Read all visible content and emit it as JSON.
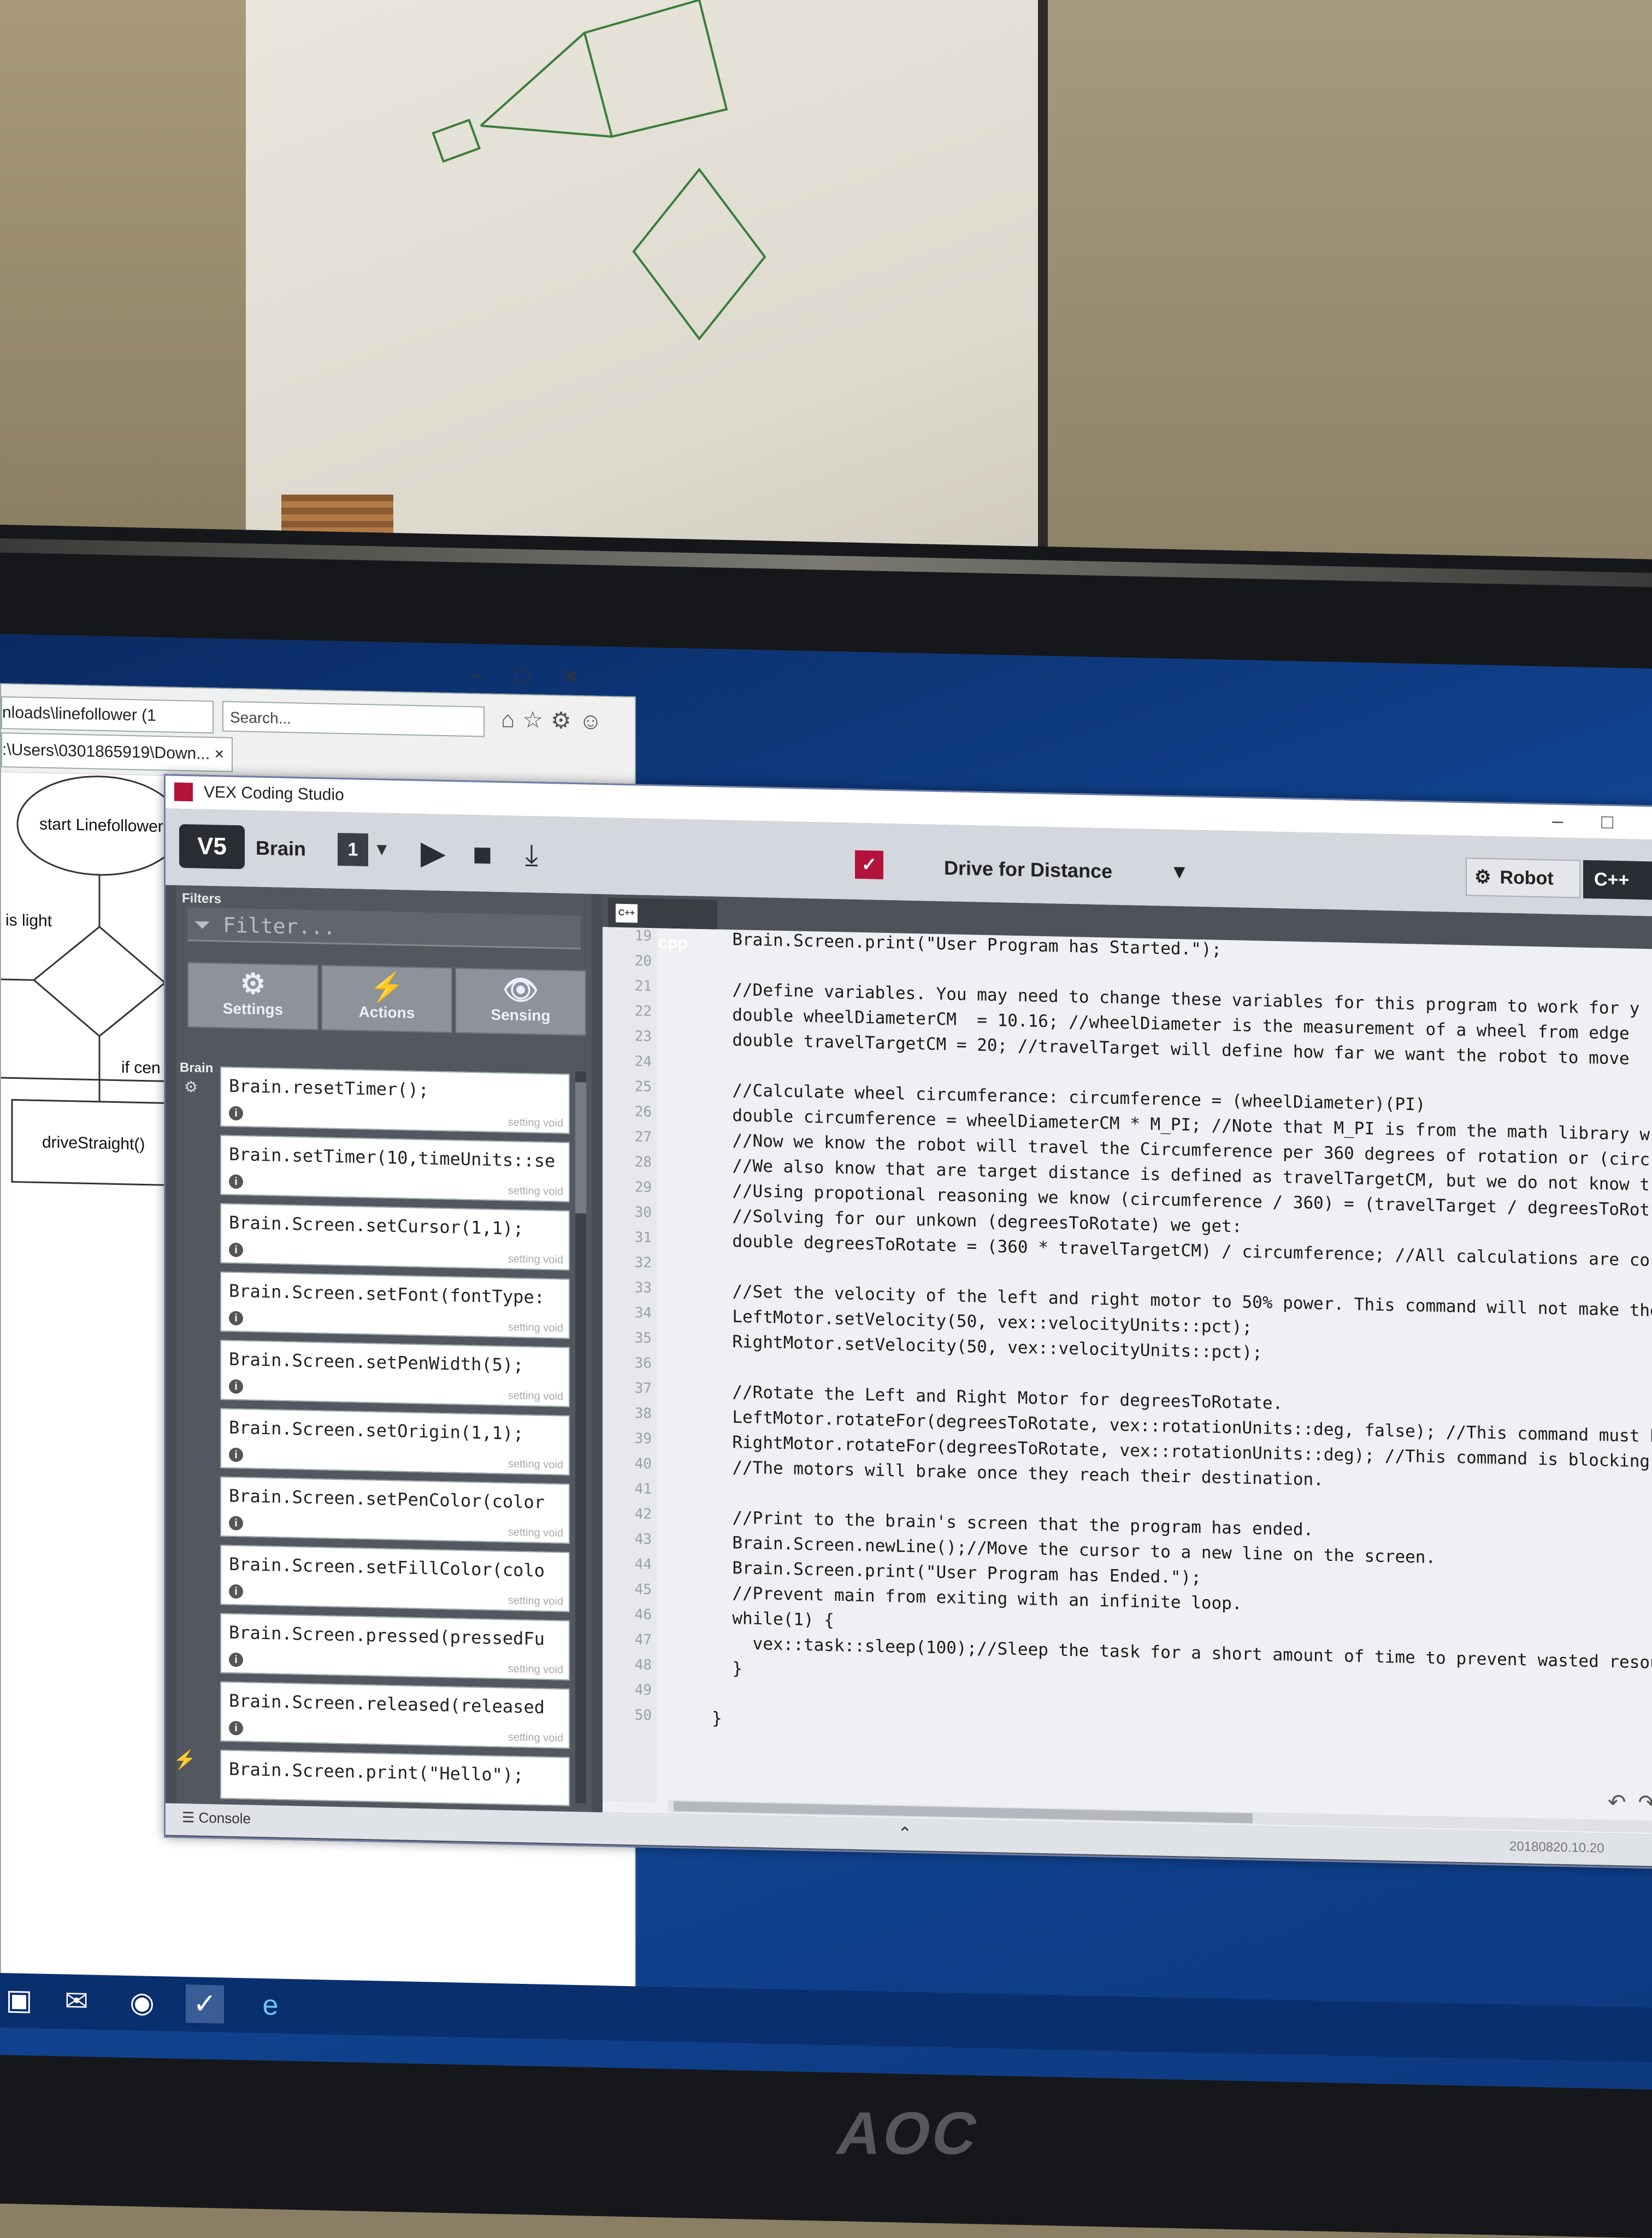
{
  "ie_window": {
    "address": "nloads\\linefollower (1",
    "search_placeholder": "Search...",
    "tab_label": ":\\Users\\0301865919\\Down...",
    "tab_close": "×",
    "flowchart": {
      "start_label": "start Linefollower",
      "condition_label": "is light",
      "branch_label": "if cen",
      "action_label": "driveStraight()"
    }
  },
  "vex": {
    "title": "VEX Coding Studio",
    "brain_label": "Brain",
    "slot_number": "1",
    "project_name": "Drive for Distance",
    "robot_button": "Robot",
    "filters_label": "Filters",
    "filter_placeholder": "Filter...",
    "categories": [
      {
        "label": "Settings",
        "icon": "gears-icon"
      },
      {
        "label": "Actions",
        "icon": "lightning-icon"
      },
      {
        "label": "Sensing",
        "icon": "eye-icon"
      }
    ],
    "brain_section": "Brain",
    "commands": [
      {
        "code": "Brain.resetTimer();",
        "type": "setting void"
      },
      {
        "code": "Brain.setTimer(10,timeUnits::se",
        "type": "setting void"
      },
      {
        "code": "Brain.Screen.setCursor(1,1);",
        "type": "setting void"
      },
      {
        "code": "Brain.Screen.setFont(fontType:",
        "type": "setting void"
      },
      {
        "code": "Brain.Screen.setPenWidth(5);",
        "type": "setting void"
      },
      {
        "code": "Brain.Screen.setOrigin(1,1);",
        "type": "setting void"
      },
      {
        "code": "Brain.Screen.setPenColor(color",
        "type": "setting void"
      },
      {
        "code": "Brain.Screen.setFillColor(colo",
        "type": "setting void"
      },
      {
        "code": "Brain.Screen.pressed(pressedFu",
        "type": "setting void"
      },
      {
        "code": "Brain.Screen.released(released",
        "type": "setting void"
      },
      {
        "code": "Brain.Screen.print(\"Hello\");",
        "type": ""
      }
    ],
    "file_tab": "main.cpp",
    "cpp_badge": "C++",
    "code_lines": [
      {
        "n": "19",
        "text": "  Brain.Screen.print(\"User Program has Started.\");"
      },
      {
        "n": "20",
        "text": ""
      },
      {
        "n": "21",
        "text": "  //Define variables. You may need to change these variables for this program to work for y"
      },
      {
        "n": "22",
        "text": "  double wheelDiameterCM  = 10.16; //wheelDiameter is the measurement of a wheel from edge"
      },
      {
        "n": "23",
        "text": "  double travelTargetCM = 20; //travelTarget will define how far we want the robot to move"
      },
      {
        "n": "24",
        "text": ""
      },
      {
        "n": "25",
        "text": "  //Calculate wheel circumferance: circumference = (wheelDiameter)(PI)"
      },
      {
        "n": "26",
        "text": "  double circumference = wheelDiameterCM * M_PI; //Note that M_PI is from the math library w"
      },
      {
        "n": "27",
        "text": "  //Now we know the robot will travel the Circumference per 360 degrees of rotation or (circ"
      },
      {
        "n": "28",
        "text": "  //We also know that are target distance is defined as travelTargetCM, but we do not know t"
      },
      {
        "n": "29",
        "text": "  //Using propotional reasoning we know (circumference / 360) = (travelTarget / degreesToRot"
      },
      {
        "n": "30",
        "text": "  //Solving for our unkown (degreesToRotate) we get:"
      },
      {
        "n": "31",
        "text": "  double degreesToRotate = (360 * travelTargetCM) / circumference; //All calculations are co"
      },
      {
        "n": "32",
        "text": ""
      },
      {
        "n": "33",
        "text": "  //Set the velocity of the left and right motor to 50% power. This command will not make the"
      },
      {
        "n": "34",
        "text": "  LeftMotor.setVelocity(50, vex::velocityUnits::pct);"
      },
      {
        "n": "35",
        "text": "  RightMotor.setVelocity(50, vex::velocityUnits::pct);"
      },
      {
        "n": "36",
        "text": ""
      },
      {
        "n": "37",
        "text": "  //Rotate the Left and Right Motor for degreesToRotate."
      },
      {
        "n": "38",
        "text": "  LeftMotor.rotateFor(degreesToRotate, vex::rotationUnits::deg, false); //This command must b"
      },
      {
        "n": "39",
        "text": "  RightMotor.rotateFor(degreesToRotate, vex::rotationUnits::deg); //This command is blocking"
      },
      {
        "n": "40",
        "text": "  //The motors will brake once they reach their destination."
      },
      {
        "n": "41",
        "text": ""
      },
      {
        "n": "42",
        "text": "  //Print to the brain's screen that the program has ended."
      },
      {
        "n": "43",
        "text": "  Brain.Screen.newLine();//Move the cursor to a new line on the screen."
      },
      {
        "n": "44",
        "text": "  Brain.Screen.print(\"User Program has Ended.\");"
      },
      {
        "n": "45",
        "text": "  //Prevent main from exiting with an infinite loop."
      },
      {
        "n": "46",
        "text": "  while(1) {"
      },
      {
        "n": "47",
        "text": "    vex::task::sleep(100);//Sleep the task for a short amount of time to prevent wasted resou"
      },
      {
        "n": "48",
        "text": "  }"
      },
      {
        "n": "49",
        "text": ""
      },
      {
        "n": "50",
        "text": "}"
      }
    ],
    "console_label": "Console",
    "version": "20180820.10.20"
  },
  "monitor_brand": "AOC",
  "accent_colors": {
    "vex_red": "#b3123a",
    "panel": "#53575f",
    "taskbar": "#0a2f6e"
  }
}
